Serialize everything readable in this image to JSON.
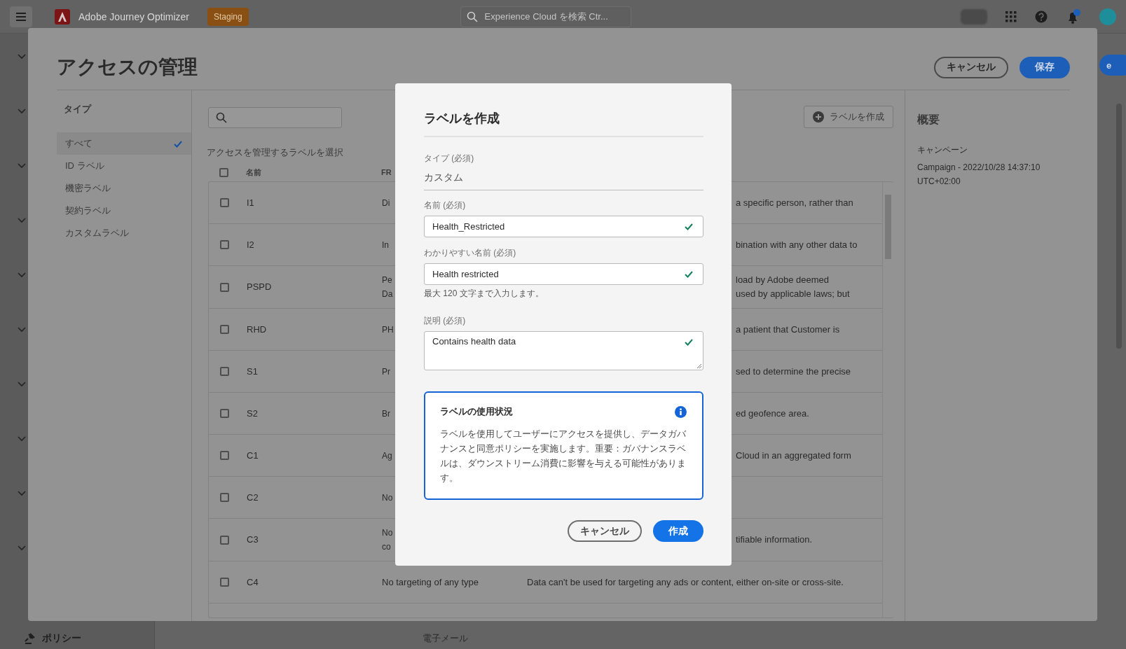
{
  "top_bar": {
    "product": "Adobe Journey Optimizer",
    "environment_badge": "Staging",
    "search": {
      "placeholder": "Experience Cloud を検索 Ctr..."
    }
  },
  "background": {
    "nav_bottom_item": "ポリシー",
    "center_label": "電子メール",
    "edge_button": "e"
  },
  "panel": {
    "title": "アクセスの管理",
    "buttons": [
      {
        "label": "キャンセル",
        "kind": "secondary"
      },
      {
        "label": "保存",
        "kind": "primary"
      }
    ],
    "filter": {
      "heading": "タイプ",
      "items": [
        {
          "label": "すべて",
          "selected": true
        },
        {
          "label": "ID ラベル",
          "selected": false
        },
        {
          "label": "機密ラベル",
          "selected": false
        },
        {
          "label": "契約ラベル",
          "selected": false
        },
        {
          "label": "カスタムラベル",
          "selected": false
        }
      ]
    },
    "create_button": "ラベルを作成",
    "table": {
      "caption": "アクセスを管理するラベルを選択",
      "select_all_checked": false,
      "columns": [
        "名前",
        "FR"
      ],
      "rows": [
        {
          "name": "I1",
          "column_2": "Di",
          "column_3": "a specific person, rather than",
          "kind": "covered",
          "checked": false
        },
        {
          "name": "I2",
          "column_2": "In",
          "column_3": "bination with any other data to",
          "kind": "covered",
          "checked": false
        },
        {
          "name": "PSPD",
          "column_2": "Pe\nDa",
          "column_3": "load by Adobe deemed\nused by applicable laws; but",
          "kind": "covered",
          "checked": false
        },
        {
          "name": "RHD",
          "column_2": "PH",
          "column_3": "a patient that Customer is",
          "kind": "covered",
          "checked": false
        },
        {
          "name": "S1",
          "column_2": "Pr",
          "column_3": "sed to determine the precise",
          "kind": "covered",
          "checked": false
        },
        {
          "name": "S2",
          "column_2": "Br",
          "column_3": "ed geofence area.",
          "kind": "covered",
          "checked": false
        },
        {
          "name": "C1",
          "column_2": "Ag",
          "column_3": "Cloud in an aggregated form",
          "kind": "covered",
          "checked": false
        },
        {
          "name": "C2",
          "column_2": "No",
          "kind": "covered",
          "checked": false
        },
        {
          "name": "C3",
          "column_2": "No\nco",
          "column_3": "tifiable information.",
          "kind": "covered",
          "checked": false
        },
        {
          "name": "C4",
          "column_2": "No targeting of any type",
          "column_3": "Data can't be used for targeting any ads or content, either on-site or cross-site.",
          "kind": "clear",
          "checked": false
        }
      ]
    },
    "summary": {
      "heading": "概要",
      "type": "キャンペーン",
      "detail": "Campaign - 2022/10/28 14:37:10 UTC+02:00"
    }
  },
  "dialog": {
    "title": "ラベルを作成",
    "type_field": {
      "label": "タイプ (必須)",
      "value": "カスタム"
    },
    "fields": [
      {
        "label": "名前 (必須)",
        "value": "Health_Restricted",
        "valid": true,
        "kind": "input"
      },
      {
        "label": "わかりやすい名前 (必須)",
        "value": "Health restricted",
        "valid": true,
        "kind": "input",
        "help": "最大 120 文字まで入力します。"
      },
      {
        "label": "説明 (必須)",
        "value": "Contains health data",
        "valid": true,
        "kind": "textarea"
      }
    ],
    "notice": {
      "title": "ラベルの使用状況",
      "body": "ラベルを使用してユーザーにアクセスを提供し、データガバナンスと同意ポリシーを実施します。重要：ガバナンスラベルは、ダウンストリーム消費に影響を与える可能性があります。"
    },
    "buttons": [
      {
        "label": "キャンセル",
        "kind": "secondary"
      },
      {
        "label": "作成",
        "kind": "primary"
      }
    ]
  }
}
